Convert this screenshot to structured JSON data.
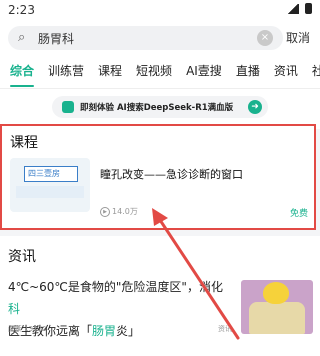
{
  "status": {
    "time": "2:23"
  },
  "search": {
    "query": "肠胃科",
    "cancel_label": "取消",
    "clear": "×"
  },
  "tabs": [
    "综合",
    "训练营",
    "课程",
    "短视频",
    "AI壹搜",
    "直播",
    "资讯",
    "社"
  ],
  "banner": {
    "text": "即刻体验 AI搜索DeepSeek-R1满血版"
  },
  "course": {
    "section_title": "课程",
    "thumb_text": "四三壹房",
    "name": "瞳孔改变——急诊诊断的窗口",
    "views": "14.0万",
    "price": "免费"
  },
  "info": {
    "section_title": "资讯",
    "line1_a": "4℃~60℃是食物的\"危险温度区\"，消化",
    "line1_hl": "科",
    "line2_a": "医生教你远离「",
    "line2_hl": "肠胃",
    "line2_b": "炎」",
    "reads": "阅读 13172",
    "source": "资讯"
  },
  "colors": {
    "accent": "#19b28e",
    "highlight_border": "#e24a45"
  }
}
